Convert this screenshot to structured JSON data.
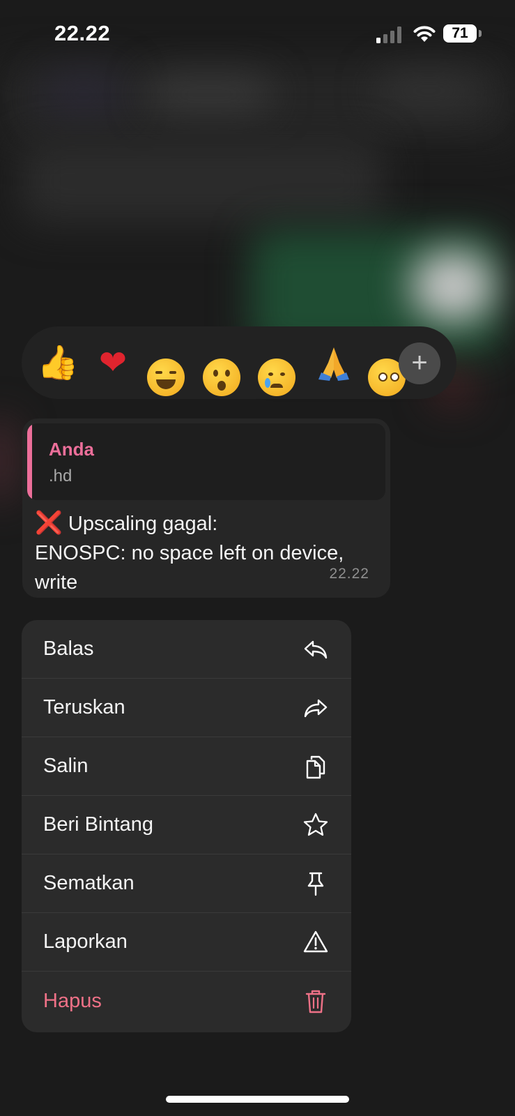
{
  "status_bar": {
    "time": "22.22",
    "battery": "71"
  },
  "reactions": {
    "emojis": [
      "👍",
      "❤",
      "😂",
      "😮",
      "😢",
      "🙏",
      "🥹"
    ],
    "add_label": "+"
  },
  "message": {
    "quote_author": "Anda",
    "quote_text": ".hd",
    "cross": "❌",
    "line1": " Upscaling gagal:",
    "line2": "ENOSPC: no space left on device, write",
    "time": "22.22"
  },
  "menu": {
    "items": [
      {
        "label": "Balas",
        "icon": "reply-icon"
      },
      {
        "label": "Teruskan",
        "icon": "forward-icon"
      },
      {
        "label": "Salin",
        "icon": "copy-icon"
      },
      {
        "label": "Beri Bintang",
        "icon": "star-icon"
      },
      {
        "label": "Sematkan",
        "icon": "pin-icon"
      },
      {
        "label": "Laporkan",
        "icon": "warning-icon"
      },
      {
        "label": "Hapus",
        "icon": "trash-icon"
      }
    ]
  },
  "colors": {
    "accent_pink": "#ec6f9a",
    "danger": "#ee7187",
    "cross_red": "#e0232e"
  }
}
